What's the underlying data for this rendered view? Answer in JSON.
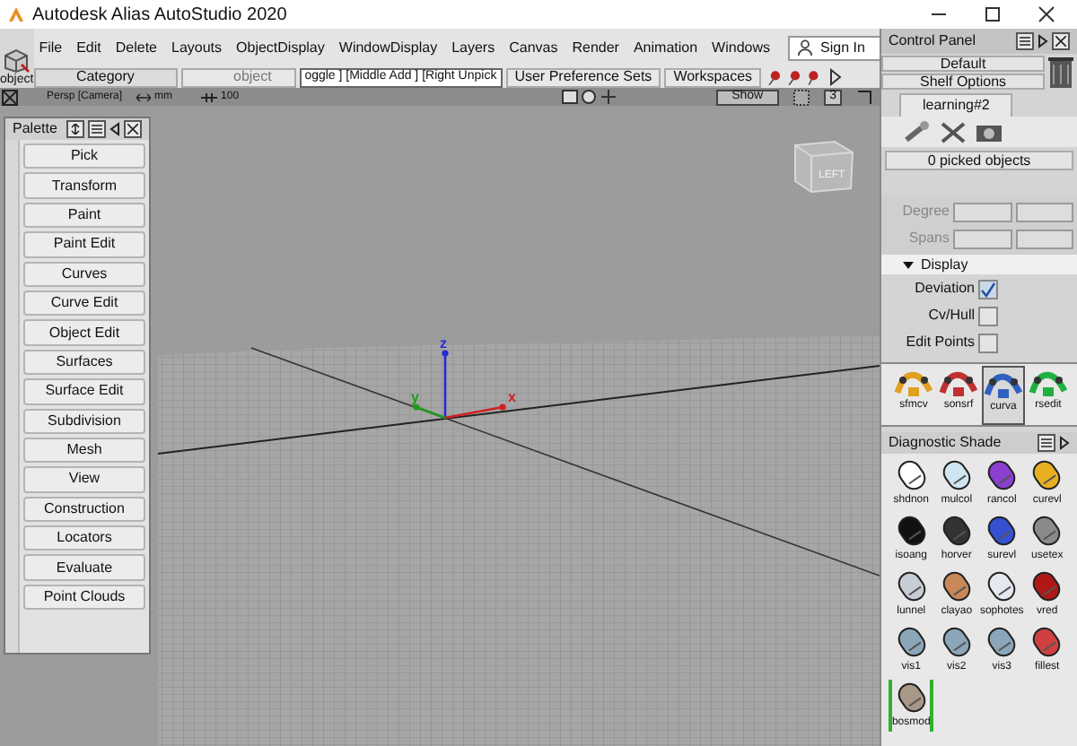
{
  "window": {
    "title": "Autodesk Alias AutoStudio 2020"
  },
  "tool_icon": {
    "label": "object"
  },
  "menu": [
    "File",
    "Edit",
    "Delete",
    "Layouts",
    "ObjectDisplay",
    "WindowDisplay",
    "Layers",
    "Canvas",
    "Render",
    "Animation",
    "Windows"
  ],
  "sign_in": "Sign In",
  "toolbar": {
    "category": "Category",
    "search_placeholder": "object",
    "marking_menu": "oggle ] [Middle Add ] [Right Unpick",
    "preference_sets": "User Preference Sets",
    "workspaces": "Workspaces"
  },
  "view_bar": {
    "camera": "Persp [Camera]",
    "units": "mm",
    "scale": "100",
    "show": "Show",
    "count": "3"
  },
  "viewport": {
    "view_cube": "LEFT",
    "axes": [
      {
        "label": "z",
        "color": "#2a2ad8"
      },
      {
        "label": "y",
        "color": "#1f9a1f"
      },
      {
        "label": "x",
        "color": "#d02020"
      }
    ]
  },
  "palette": {
    "title": "Palette",
    "items": [
      "Pick",
      "Transform",
      "Paint",
      "Paint Edit",
      "Curves",
      "Curve Edit",
      "Object Edit",
      "Surfaces",
      "Surface Edit",
      "Subdivision",
      "Mesh",
      "View",
      "Construction",
      "Locators",
      "Evaluate",
      "Point Clouds"
    ]
  },
  "control_panel": {
    "title": "Control Panel",
    "layout": "Default",
    "shelf_options": "Shelf Options",
    "tabs": [
      {
        "label": "learning#2",
        "selected": true
      }
    ],
    "picked": "0 picked objects",
    "fields": [
      {
        "label": "Degree",
        "disabled": true
      },
      {
        "label": "Spans",
        "disabled": true
      }
    ],
    "display": {
      "title": "Display",
      "expanded": true,
      "options": [
        {
          "label": "Deviation",
          "checked": true
        },
        {
          "label": "Cv/Hull",
          "checked": false
        },
        {
          "label": "Edit Points",
          "checked": false
        }
      ]
    },
    "shelf": [
      {
        "label": "sfmcv",
        "selected": false,
        "color": "#e0a020"
      },
      {
        "label": "sonsrf",
        "selected": false,
        "color": "#c03030"
      },
      {
        "label": "curva",
        "selected": true,
        "color": "#3060c0"
      },
      {
        "label": "rsedit",
        "selected": false,
        "color": "#20b040"
      }
    ]
  },
  "diagnostic_shade": {
    "title": "Diagnostic Shade",
    "items": [
      {
        "label": "shdnon",
        "color": "#ffffff",
        "selected": false
      },
      {
        "label": "mulcol",
        "color": "#cfe6f0",
        "selected": false
      },
      {
        "label": "rancol",
        "color": "#8a3fd0",
        "selected": false
      },
      {
        "label": "curevl",
        "color": "#e8b020",
        "selected": false
      },
      {
        "label": "isoang",
        "color": "#111111",
        "selected": false
      },
      {
        "label": "horver",
        "color": "#333333",
        "selected": false
      },
      {
        "label": "surevl",
        "color": "#3550d0",
        "selected": false
      },
      {
        "label": "usetex",
        "color": "#8a8a8a",
        "selected": false
      },
      {
        "label": "lunnel",
        "color": "#c8ccd4",
        "selected": false
      },
      {
        "label": "clayao",
        "color": "#c88858",
        "selected": false
      },
      {
        "label": "sophotes",
        "color": "#e4e8f0",
        "selected": false
      },
      {
        "label": "vred",
        "color": "#b01818",
        "selected": false
      },
      {
        "label": "vis1",
        "color": "#8aa6b8",
        "selected": false
      },
      {
        "label": "vis2",
        "color": "#8aa6b8",
        "selected": false
      },
      {
        "label": "vis3",
        "color": "#8aa6b8",
        "selected": false
      },
      {
        "label": "fillest",
        "color": "#d04040",
        "selected": false
      },
      {
        "label": "bosmod",
        "color": "#a89888",
        "selected": true
      }
    ]
  }
}
